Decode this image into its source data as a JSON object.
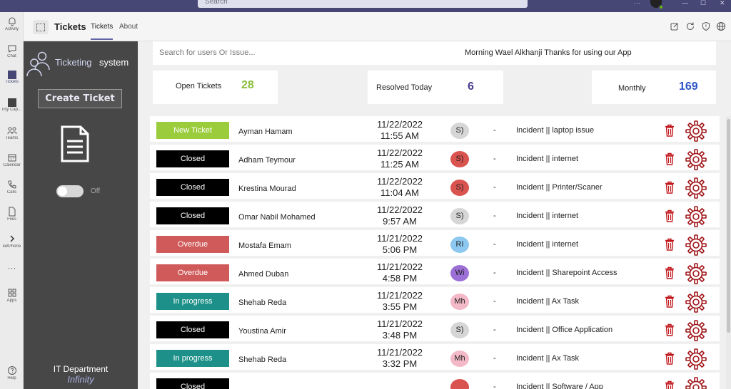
{
  "teams": {
    "search_placeholder": "Search",
    "rail": [
      {
        "label": "Activity",
        "icon": "bell-icon"
      },
      {
        "label": "Chat",
        "icon": "chat-icon"
      },
      {
        "label": "Tickets",
        "icon": "tickets-app-icon"
      },
      {
        "label": "nity Cap...",
        "icon": "community-app-icon"
      },
      {
        "label": "Teams",
        "icon": "teams-icon"
      },
      {
        "label": "Calendar",
        "icon": "calendar-icon"
      },
      {
        "label": "Calls",
        "icon": "phone-icon"
      },
      {
        "label": "Files",
        "icon": "files-icon"
      },
      {
        "label": "ketPhone",
        "icon": "chevron-right-icon"
      },
      {
        "label": "",
        "icon": "more-icon"
      },
      {
        "label": "Apps",
        "icon": "apps-icon"
      },
      {
        "label": "Help",
        "icon": "help-icon"
      }
    ],
    "top_icons": [
      "more-icon",
      "minimize-icon",
      "maximize-icon",
      "close-icon"
    ]
  },
  "app_header": {
    "title": "Tickets",
    "tabs": [
      {
        "label": "Tickets",
        "active": true
      },
      {
        "label": "About",
        "active": false
      }
    ],
    "icons": [
      "popout-icon",
      "refresh-icon",
      "shield-icon",
      "globe-icon"
    ]
  },
  "sidebar": {
    "brand_word1": "Ticketing",
    "brand_word2": "system",
    "create_ticket_label": "Create Ticket",
    "toggle_label": "Off",
    "toggle_on": false,
    "department": "IT Department",
    "department_sub": "Infinity"
  },
  "main": {
    "search_placeholder": "Search for users Or Issue...",
    "greeting": "Morning Wael Alkhanji Thanks for using our App",
    "stats": {
      "open": {
        "label": "Open Tickets",
        "value": "28",
        "color": "#8bbf3a"
      },
      "resolved": {
        "label": "Resolved Today",
        "value": "6",
        "color": "#4b3a8f"
      },
      "monthly": {
        "label": "Monthly",
        "value": "169",
        "color": "#2f54c7"
      }
    },
    "tickets": [
      {
        "status": "New Ticket",
        "status_class": "st-new",
        "name": "Ayman Hamam",
        "date": "11/22/2022",
        "time": "11:55 AM",
        "initials": "S)",
        "avatar_color": "#d6d6d6",
        "dash": "-",
        "desc": "Incident || laptop issue"
      },
      {
        "status": "Closed",
        "status_class": "st-closed",
        "name": "Adham Teymour",
        "date": "11/22/2022",
        "time": "11:25 AM",
        "initials": "S)",
        "avatar_color": "#d9534f",
        "dash": "-",
        "desc": "Incident || internet"
      },
      {
        "status": "Closed",
        "status_class": "st-closed",
        "name": "Krestina Mourad",
        "date": "11/22/2022",
        "time": "11:04 AM",
        "initials": "S)",
        "avatar_color": "#d9534f",
        "dash": "-",
        "desc": "Incident || Printer/Scaner"
      },
      {
        "status": "Closed",
        "status_class": "st-closed",
        "name": "Omar Nabil Mohamed",
        "date": "11/22/2022",
        "time": "9:57 AM",
        "initials": "S)",
        "avatar_color": "#d6d6d6",
        "dash": "-",
        "desc": "Incident || internet"
      },
      {
        "status": "Overdue",
        "status_class": "st-overdue",
        "name": "Mostafa Emam",
        "date": "11/21/2022",
        "time": "5:06 PM",
        "initials": "RI",
        "avatar_color": "#8cc8f0",
        "dash": "-",
        "desc": "Incident || internet"
      },
      {
        "status": "Overdue",
        "status_class": "st-overdue",
        "name": "Ahmed Duban",
        "date": "11/21/2022",
        "time": "4:58 PM",
        "initials": "Wi",
        "avatar_color": "#9b6fd6",
        "dash": "-",
        "desc": "Incident || Sharepoint Access"
      },
      {
        "status": "In progress",
        "status_class": "st-progress",
        "name": "Shehab Reda",
        "date": "11/21/2022",
        "time": "3:55 PM",
        "initials": "Mh",
        "avatar_color": "#f3b9c8",
        "dash": "-",
        "desc": "Incident || Ax Task"
      },
      {
        "status": "Closed",
        "status_class": "st-closed",
        "name": "Youstina Amir",
        "date": "11/21/2022",
        "time": "3:48 PM",
        "initials": "S)",
        "avatar_color": "#d6d6d6",
        "dash": "-",
        "desc": "Incident || Office Application"
      },
      {
        "status": "In progress",
        "status_class": "st-progress",
        "name": "Shehab Reda",
        "date": "11/21/2022",
        "time": "3:32 PM",
        "initials": "Mh",
        "avatar_color": "#f3b9c8",
        "dash": "-",
        "desc": "Incident || Ax Task"
      },
      {
        "status": "Closed",
        "status_class": "st-closed",
        "name": "",
        "date": "",
        "time": "",
        "initials": "",
        "avatar_color": "#d9534f",
        "dash": "-",
        "desc": "Incident || Software / App"
      }
    ],
    "colors": {
      "trash": "#c0161a",
      "gear": "#a0161a"
    }
  }
}
